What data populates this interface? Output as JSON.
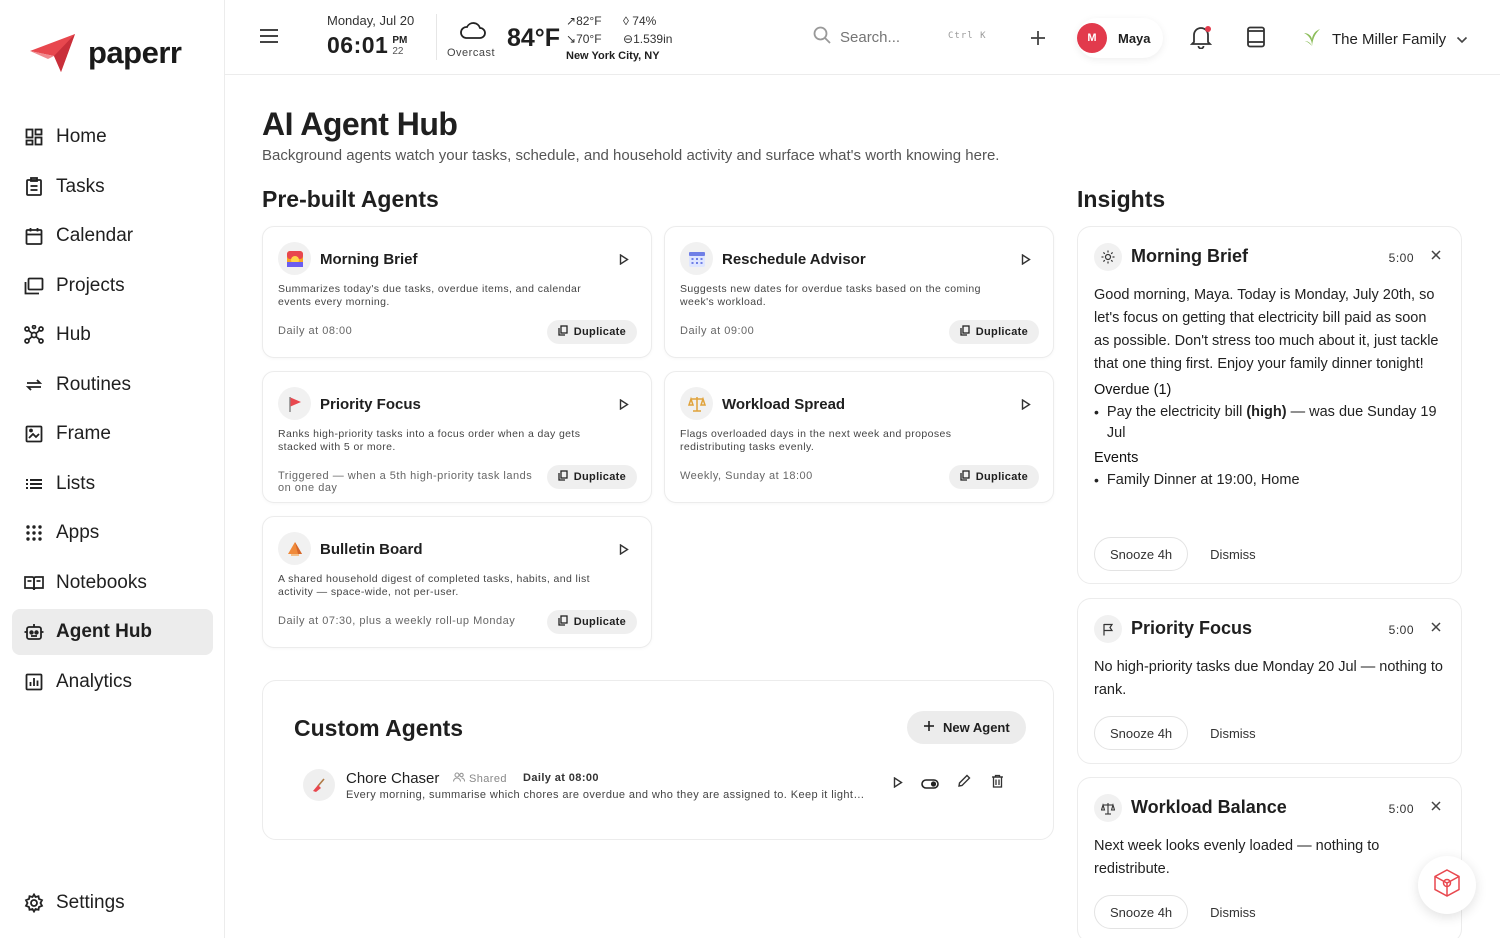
{
  "app": {
    "name": "paperr"
  },
  "colors": {
    "brand": "#e8474e",
    "active_nav_bg": "#ececec",
    "avatar": "#e23a4c"
  },
  "sidebar": {
    "items": [
      {
        "label": "Home",
        "icon": "home-icon"
      },
      {
        "label": "Tasks",
        "icon": "tasks-icon"
      },
      {
        "label": "Calendar",
        "icon": "calendar-icon"
      },
      {
        "label": "Projects",
        "icon": "projects-icon"
      },
      {
        "label": "Hub",
        "icon": "hub-icon"
      },
      {
        "label": "Routines",
        "icon": "routines-icon"
      },
      {
        "label": "Frame",
        "icon": "frame-icon"
      },
      {
        "label": "Lists",
        "icon": "lists-icon"
      },
      {
        "label": "Apps",
        "icon": "apps-icon"
      },
      {
        "label": "Notebooks",
        "icon": "notebooks-icon"
      },
      {
        "label": "Agent Hub",
        "icon": "agent-hub-icon",
        "active": true
      },
      {
        "label": "Analytics",
        "icon": "analytics-icon"
      }
    ],
    "settings_label": "Settings"
  },
  "topbar": {
    "date": "Monday, Jul 20",
    "time": "06:01",
    "ampm": "PM",
    "seconds": "22",
    "weather": {
      "condition": "Overcast",
      "temp": "84°F",
      "high": "82°F",
      "low": "70°F",
      "humidity": "74%",
      "pressure": "1.539in",
      "city": "New York City, NY"
    },
    "search_placeholder": "Search...",
    "search_shortcut": "Ctrl K",
    "user": {
      "initial": "M",
      "name": "Maya"
    },
    "family": "The Miller Family"
  },
  "page": {
    "title": "AI Agent Hub",
    "subtitle": "Background agents watch your tasks, schedule, and household activity and surface what's worth knowing here.",
    "prebuilt_title": "Pre-built Agents",
    "insights_title": "Insights"
  },
  "prebuilt": [
    {
      "title": "Morning Brief",
      "desc": "Summarizes today's due tasks, overdue items, and calendar events every morning.",
      "schedule": "Daily at 08:00",
      "duplicate": "Duplicate",
      "icon": "sunrise-icon"
    },
    {
      "title": "Reschedule Advisor",
      "desc": "Suggests new dates for overdue tasks based on the coming week's workload.",
      "schedule": "Daily at 09:00",
      "duplicate": "Duplicate",
      "icon": "calendar-grid-icon"
    },
    {
      "title": "Priority Focus",
      "desc": "Ranks high-priority tasks into a focus order when a day gets stacked with 5 or more.",
      "schedule": "Triggered — when a 5th high-priority task lands on one day",
      "duplicate": "Duplicate",
      "icon": "red-flag-icon"
    },
    {
      "title": "Workload Spread",
      "desc": "Flags overloaded days in the next week and proposes redistributing tasks evenly.",
      "schedule": "Weekly, Sunday at 18:00",
      "duplicate": "Duplicate",
      "icon": "balance-scale-icon"
    },
    {
      "title": "Bulletin Board",
      "desc": "A shared household digest of completed tasks, habits, and list activity — space-wide, not per-user.",
      "schedule": "Daily at 07:30, plus a weekly roll-up Monday",
      "duplicate": "Duplicate",
      "icon": "megaphone-icon"
    }
  ],
  "custom": {
    "title": "Custom Agents",
    "new_label": "New Agent",
    "agents": [
      {
        "name": "Chore Chaser",
        "shared": "Shared",
        "schedule": "Daily at 08:00",
        "desc": "Every morning, summarise which chores are overdue and who they are assigned to. Keep it light and friendly."
      }
    ]
  },
  "insights": [
    {
      "title": "Morning Brief",
      "time": "5:00",
      "icon": "sun-icon",
      "body": "Good morning, Maya. Today is Monday, July 20th, so let's focus on getting that electricity bill paid as soon as possible. Don't stress too much about it, just tackle that one thing first. Enjoy your family dinner tonight!",
      "overdue_heading": "Overdue (1)",
      "overdue_item_pre": "Pay the electricity bill ",
      "overdue_item_bold": "(high)",
      "overdue_item_post": " — was due Sunday 19 Jul",
      "events_heading": "Events",
      "event_item": "Family Dinner at 19:00, Home",
      "snooze": "Snooze 4h",
      "dismiss": "Dismiss"
    },
    {
      "title": "Priority Focus",
      "time": "5:00",
      "icon": "flag-icon",
      "body": "No high-priority tasks due Monday 20 Jul — nothing to rank.",
      "snooze": "Snooze 4h",
      "dismiss": "Dismiss"
    },
    {
      "title": "Workload Balance",
      "time": "5:00",
      "icon": "scale-icon",
      "body": "Next week looks evenly loaded — nothing to redistribute.",
      "snooze": "Snooze 4h",
      "dismiss": "Dismiss"
    }
  ]
}
